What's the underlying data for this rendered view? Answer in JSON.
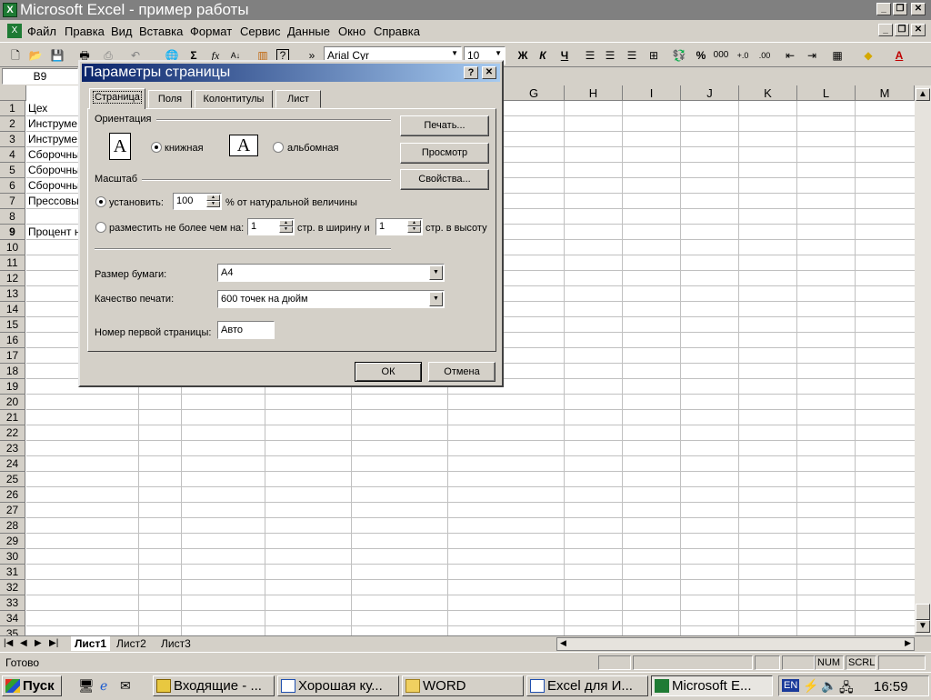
{
  "window": {
    "title": "Microsoft Excel - пример работы"
  },
  "menu": [
    "Файл",
    "Правка",
    "Вид",
    "Вставка",
    "Формат",
    "Сервис",
    "Данные",
    "Окно",
    "Справка"
  ],
  "toolbar": {
    "font": "Arial Cyr",
    "size": "10",
    "bold": "Ж",
    "italic": "К",
    "underline": "Ч",
    "percent": "%",
    "thousands": "000"
  },
  "formula": {
    "namebox": "B9"
  },
  "columns": [
    "G",
    "H",
    "I",
    "J",
    "K",
    "L",
    "M"
  ],
  "rows": [
    "1",
    "2",
    "3",
    "4",
    "5",
    "6",
    "7",
    "8",
    "9",
    "10",
    "11",
    "12",
    "13",
    "14",
    "15",
    "16",
    "17",
    "18",
    "19",
    "20",
    "21",
    "22",
    "23",
    "24",
    "25",
    "26",
    "27",
    "28",
    "29",
    "30",
    "31",
    "32",
    "33",
    "34",
    "35"
  ],
  "cells": [
    "Цех",
    "Инструме",
    "Инструме",
    "Сборочны",
    "Сборочны",
    "Сборочны",
    "Прессовы",
    "",
    "Процент н"
  ],
  "sheets": [
    "Лист1",
    "Лист2",
    "Лист3"
  ],
  "status": {
    "ready": "Готово",
    "num": "NUM",
    "scrl": "SCRL"
  },
  "dialog": {
    "title": "Параметры страницы",
    "help": "?",
    "close": "✕",
    "tabs": [
      "Страница",
      "Поля",
      "Колонтитулы",
      "Лист"
    ],
    "orientation_label": "Ориентация",
    "portrait": "книжная",
    "landscape": "альбомная",
    "scale_label": "Масштаб",
    "set_label": "установить:",
    "set_value": "100",
    "set_suffix": "% от натуральной величины",
    "fit_label": "разместить не более чем на:",
    "fit_wide": "1",
    "fit_wide_suffix": "стр. в ширину и",
    "fit_tall": "1",
    "fit_tall_suffix": "стр. в высоту",
    "paper_label": "Размер бумаги:",
    "paper_value": "A4",
    "quality_label": "Качество печати:",
    "quality_value": "600 точек на дюйм",
    "first_page_label": "Номер первой страницы:",
    "first_page_value": "Авто",
    "print_btn": "Печать...",
    "preview_btn": "Просмотр",
    "props_btn": "Свойства...",
    "ok_btn": "ОК",
    "cancel_btn": "Отмена"
  },
  "taskbar": {
    "start": "Пуск",
    "tasks": [
      "Входящие - ...",
      "Хорошая ку...",
      "WORD",
      "Excel для И...",
      "Microsoft E..."
    ],
    "lang": "EN",
    "clock": "16:59"
  }
}
